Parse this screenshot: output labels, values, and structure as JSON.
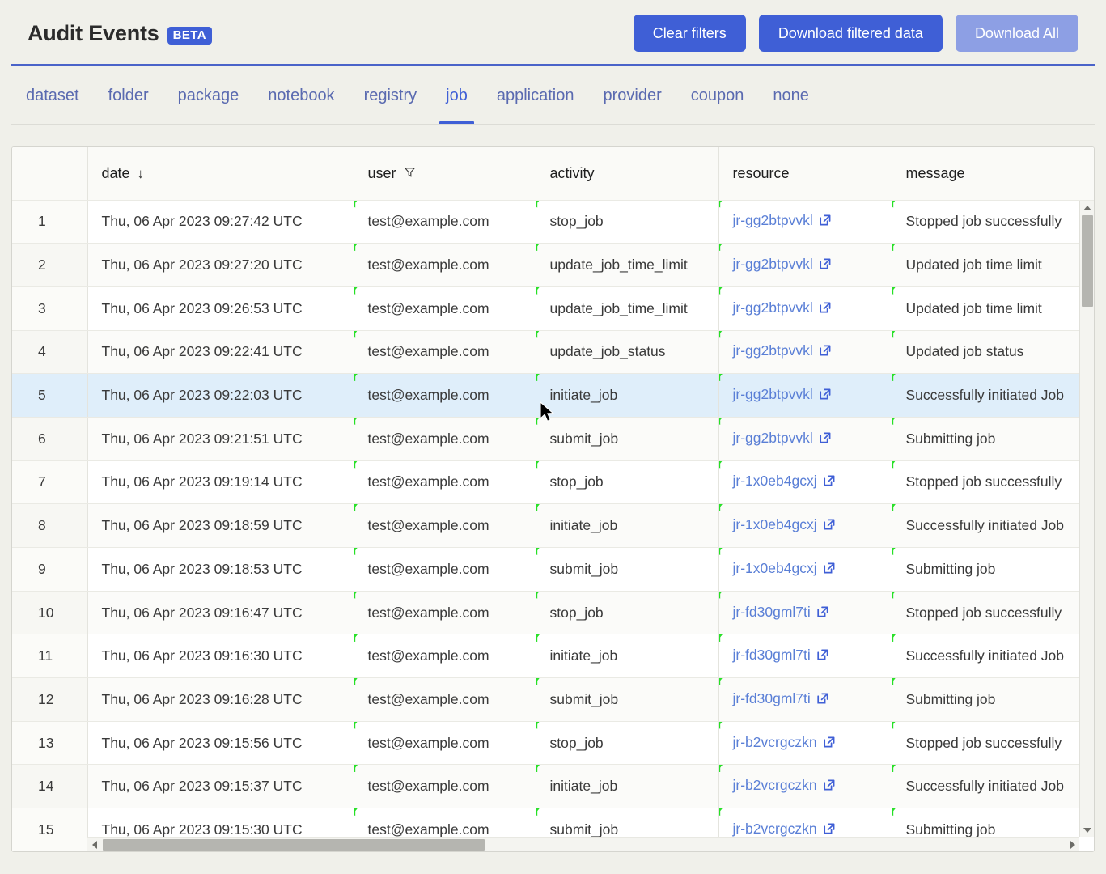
{
  "header": {
    "title": "Audit Events",
    "badge": "BETA",
    "buttons": [
      {
        "label": "Clear filters",
        "name": "clear-filters-button",
        "style": "primary",
        "enabled": true
      },
      {
        "label": "Download filtered data",
        "name": "download-filtered-data-button",
        "style": "primary",
        "enabled": true
      },
      {
        "label": "Download All",
        "name": "download-all-button",
        "style": "disabled",
        "enabled": false
      }
    ],
    "accent_color": "#3f5fd6"
  },
  "tabs": {
    "active": "job",
    "items": [
      {
        "label": "dataset"
      },
      {
        "label": "folder"
      },
      {
        "label": "package"
      },
      {
        "label": "notebook"
      },
      {
        "label": "registry"
      },
      {
        "label": "job"
      },
      {
        "label": "application"
      },
      {
        "label": "provider"
      },
      {
        "label": "coupon"
      },
      {
        "label": "none"
      }
    ]
  },
  "table": {
    "columns": [
      {
        "key": "index",
        "label": "",
        "icon": ""
      },
      {
        "key": "date",
        "label": "date",
        "icon": "sort-descending-arrow"
      },
      {
        "key": "user",
        "label": "user",
        "icon": "filter-funnel"
      },
      {
        "key": "activity",
        "label": "activity",
        "icon": ""
      },
      {
        "key": "resource",
        "label": "resource",
        "icon": ""
      },
      {
        "key": "message",
        "label": "message",
        "icon": ""
      }
    ],
    "selected_row_index": 5,
    "rows": [
      {
        "index": "1",
        "date": "Thu, 06 Apr 2023 09:27:42 UTC",
        "user": "test@example.com",
        "activity": "stop_job",
        "resource": "jr-gg2btpvvkl",
        "message": "Stopped job successfully"
      },
      {
        "index": "2",
        "date": "Thu, 06 Apr 2023 09:27:20 UTC",
        "user": "test@example.com",
        "activity": "update_job_time_limit",
        "resource": "jr-gg2btpvvkl",
        "message": "Updated job time limit"
      },
      {
        "index": "3",
        "date": "Thu, 06 Apr 2023 09:26:53 UTC",
        "user": "test@example.com",
        "activity": "update_job_time_limit",
        "resource": "jr-gg2btpvvkl",
        "message": "Updated job time limit"
      },
      {
        "index": "4",
        "date": "Thu, 06 Apr 2023 09:22:41 UTC",
        "user": "test@example.com",
        "activity": "update_job_status",
        "resource": "jr-gg2btpvvkl",
        "message": "Updated job status"
      },
      {
        "index": "5",
        "date": "Thu, 06 Apr 2023 09:22:03 UTC",
        "user": "test@example.com",
        "activity": "initiate_job",
        "resource": "jr-gg2btpvvkl",
        "message": "Successfully initiated Job"
      },
      {
        "index": "6",
        "date": "Thu, 06 Apr 2023 09:21:51 UTC",
        "user": "test@example.com",
        "activity": "submit_job",
        "resource": "jr-gg2btpvvkl",
        "message": "Submitting job"
      },
      {
        "index": "7",
        "date": "Thu, 06 Apr 2023 09:19:14 UTC",
        "user": "test@example.com",
        "activity": "stop_job",
        "resource": "jr-1x0eb4gcxj",
        "message": "Stopped job successfully"
      },
      {
        "index": "8",
        "date": "Thu, 06 Apr 2023 09:18:59 UTC",
        "user": "test@example.com",
        "activity": "initiate_job",
        "resource": "jr-1x0eb4gcxj",
        "message": "Successfully initiated Job"
      },
      {
        "index": "9",
        "date": "Thu, 06 Apr 2023 09:18:53 UTC",
        "user": "test@example.com",
        "activity": "submit_job",
        "resource": "jr-1x0eb4gcxj",
        "message": "Submitting job"
      },
      {
        "index": "10",
        "date": "Thu, 06 Apr 2023 09:16:47 UTC",
        "user": "test@example.com",
        "activity": "stop_job",
        "resource": "jr-fd30gml7ti",
        "message": "Stopped job successfully"
      },
      {
        "index": "11",
        "date": "Thu, 06 Apr 2023 09:16:30 UTC",
        "user": "test@example.com",
        "activity": "initiate_job",
        "resource": "jr-fd30gml7ti",
        "message": "Successfully initiated Job"
      },
      {
        "index": "12",
        "date": "Thu, 06 Apr 2023 09:16:28 UTC",
        "user": "test@example.com",
        "activity": "submit_job",
        "resource": "jr-fd30gml7ti",
        "message": "Submitting job"
      },
      {
        "index": "13",
        "date": "Thu, 06 Apr 2023 09:15:56 UTC",
        "user": "test@example.com",
        "activity": "stop_job",
        "resource": "jr-b2vcrgczkn",
        "message": "Stopped job successfully"
      },
      {
        "index": "14",
        "date": "Thu, 06 Apr 2023 09:15:37 UTC",
        "user": "test@example.com",
        "activity": "initiate_job",
        "resource": "jr-b2vcrgczkn",
        "message": "Successfully initiated Job"
      },
      {
        "index": "15",
        "date": "Thu, 06 Apr 2023 09:15:30 UTC",
        "user": "test@example.com",
        "activity": "submit_job",
        "resource": "jr-b2vcrgczkn",
        "message": "Submitting job"
      }
    ]
  },
  "scrollbars": {
    "vertical": {
      "thumb_top_pct": 2,
      "thumb_height_pct": 14
    },
    "horizontal": {
      "thumb_left_pct": 0,
      "thumb_width_pct": 38
    }
  }
}
